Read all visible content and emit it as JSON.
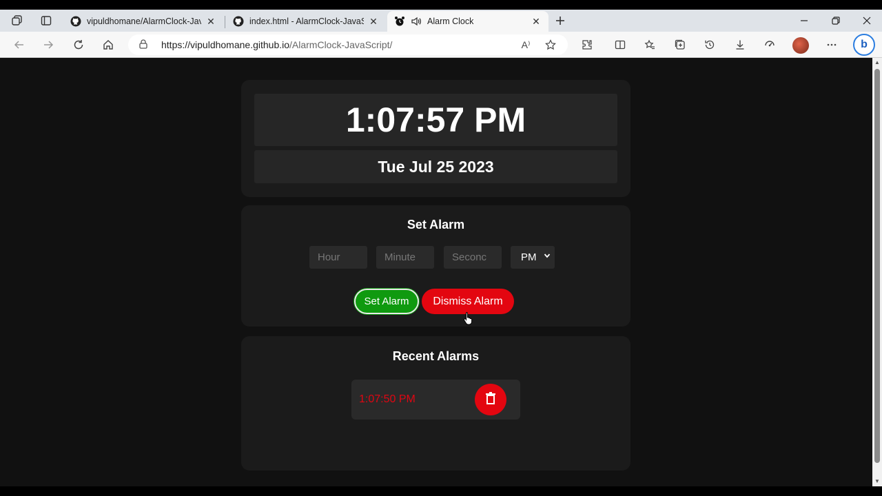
{
  "browser": {
    "tabs": [
      {
        "label": "vipuldhomane/AlarmClock-JavaS",
        "icon": "github-icon"
      },
      {
        "label": "index.html - AlarmClock-JavaScri",
        "icon": "github-icon"
      },
      {
        "label": "Alarm Clock",
        "icon": "alarm-clock-icon"
      }
    ],
    "url_host": "https://vipuldhomane.github.io",
    "url_path": "/AlarmClock-JavaScript/",
    "reader_icon": "A⁾"
  },
  "clock": {
    "time": "1:07:57 PM",
    "date": "Tue Jul 25 2023"
  },
  "set_alarm": {
    "title": "Set Alarm",
    "hour_placeholder": "Hour",
    "minute_placeholder": "Minute",
    "second_placeholder": "Seconc",
    "ampm_value": "PM",
    "set_label": "Set Alarm",
    "dismiss_label": "Dismiss Alarm"
  },
  "recent": {
    "title": "Recent Alarms",
    "alarms": [
      {
        "time": "1:07:50 PM"
      }
    ]
  },
  "colors": {
    "page_bg": "#111111",
    "card_bg": "#1b1b1b",
    "set_green": "#0f9a0f",
    "dismiss_red": "#e30610"
  }
}
